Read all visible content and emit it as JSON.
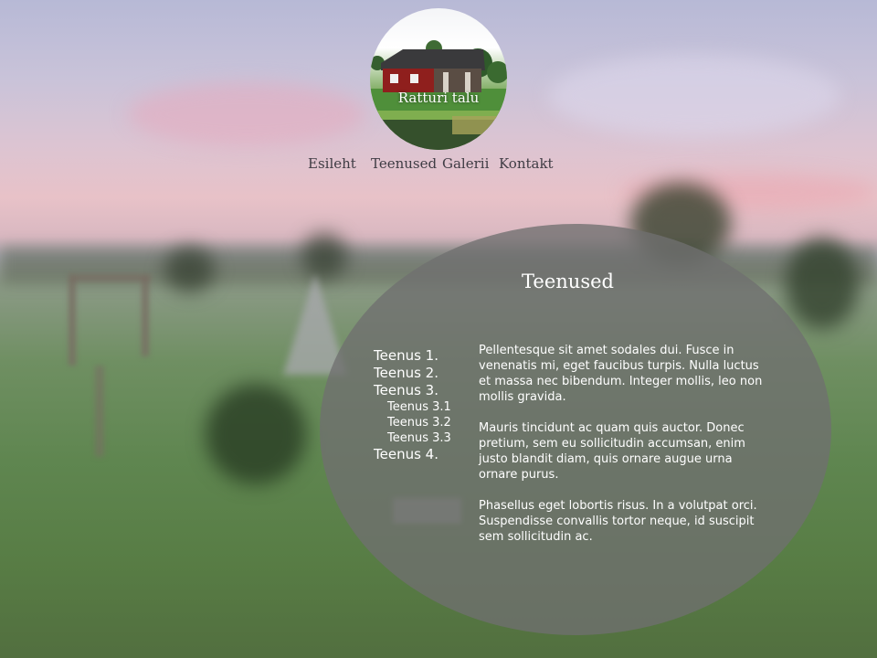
{
  "logo": {
    "title": "Ratturi talu",
    "icon": "farmhouse-photo"
  },
  "nav": {
    "items": [
      {
        "label": "Esileht"
      },
      {
        "label": "Teenused"
      },
      {
        "label": "Galerii"
      },
      {
        "label": "Kontakt"
      }
    ]
  },
  "main": {
    "title": "Teenused",
    "submenu": [
      {
        "label": "Teenus 1.",
        "level": 1
      },
      {
        "label": "Teenus 2.",
        "level": 1
      },
      {
        "label": "Teenus 3.",
        "level": 1
      },
      {
        "label": "Teenus 3.1",
        "level": 2
      },
      {
        "label": "Teenus 3.2",
        "level": 2
      },
      {
        "label": "Teenus 3.3",
        "level": 2
      },
      {
        "label": "Teenus 4.",
        "level": 1
      }
    ],
    "paragraphs": [
      "Pellentesque sit amet sodales dui. Fusce in venenatis mi, eget faucibus turpis. Nulla luctus et massa nec bibendum. Integer mollis, leo non mollis gravida.",
      "Mauris tincidunt ac quam quis auctor. Donec pretium, sem eu sollicitudin accumsan, enim justo blandit diam, quis ornare augue urna ornare purus.",
      "Phasellus eget lobortis risus. In a volutpat orci. Suspendisse convallis tortor neque, id suscipit sem sollicitudin ac."
    ]
  },
  "colors": {
    "panel": "#707070",
    "nav_text": "#3f3c44",
    "content_text": "#ffffff"
  }
}
